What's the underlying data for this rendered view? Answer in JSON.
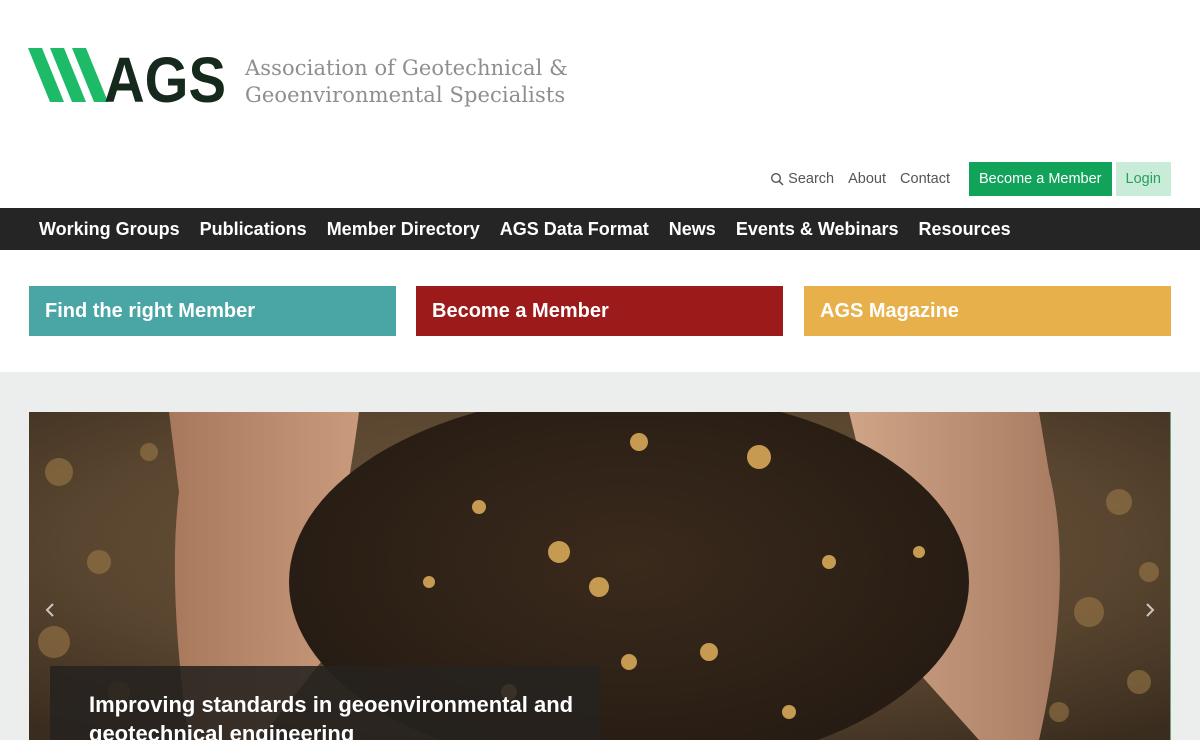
{
  "brand": {
    "logo_text": "AGS",
    "name_line1": "Association of Geotechnical &",
    "name_line2": "Geoenvironmental Specialists",
    "colors": {
      "green": "#1dbb68",
      "dark": "#16291d"
    }
  },
  "utility": {
    "search_icon": "search-icon",
    "search": "Search",
    "about": "About",
    "contact": "Contact",
    "become_member": "Become a Member",
    "login": "Login"
  },
  "nav": {
    "items": [
      {
        "label": "Working Groups"
      },
      {
        "label": "Publications"
      },
      {
        "label": "Member Directory"
      },
      {
        "label": "AGS Data Format"
      },
      {
        "label": "News"
      },
      {
        "label": "Events & Webinars"
      },
      {
        "label": "Resources"
      }
    ]
  },
  "tiles": [
    {
      "label": "Find the right Member",
      "color": "#4aa5a5"
    },
    {
      "label": "Become a Member",
      "color": "#9c1a1a"
    },
    {
      "label": "AGS Magazine",
      "color": "#e8b04a"
    }
  ],
  "hero": {
    "image": "hands-holding-soil",
    "prev_icon": "chevron-left-icon",
    "next_icon": "chevron-right-icon",
    "caption": "Improving standards in geoenvironmental and geotechnical engineering"
  }
}
